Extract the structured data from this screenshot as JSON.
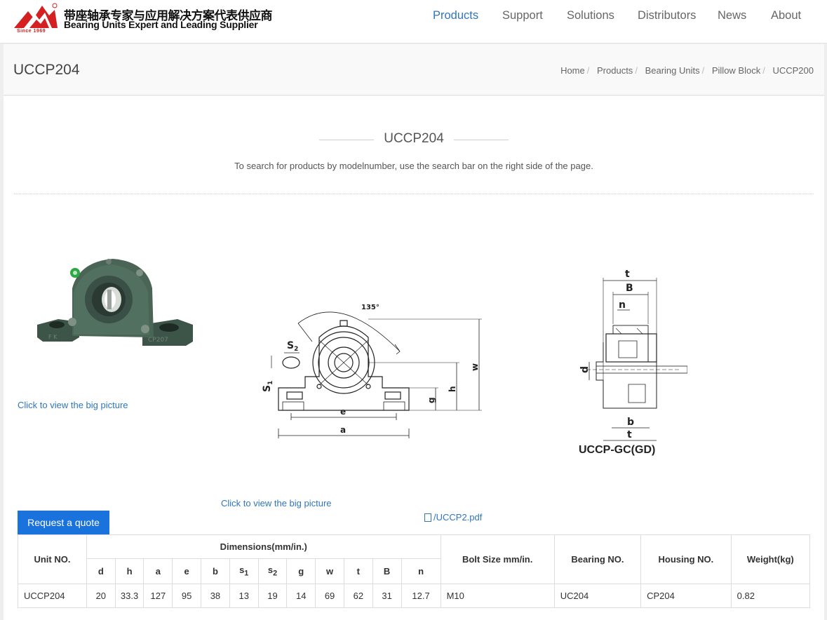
{
  "header": {
    "logo_since": "Since 1969",
    "logo_cn": "带座轴承专家与应用解决方案代表供应商",
    "logo_en": "Bearing Units Expert and Leading Supplier",
    "brand_color": "#d42020",
    "nav": [
      {
        "label": "Products",
        "active": true
      },
      {
        "label": "Support",
        "active": false
      },
      {
        "label": "Solutions",
        "active": false
      },
      {
        "label": "Distributors",
        "active": false
      },
      {
        "label": "News",
        "active": false
      },
      {
        "label": "About",
        "active": false
      }
    ]
  },
  "titlebar": {
    "title": "UCCP204",
    "breadcrumb": [
      "Home",
      "Products",
      "Bearing Units",
      "Pillow Block",
      "UCCP200"
    ]
  },
  "main": {
    "heading": "UCCP204",
    "subtext": "To search for products by modelnumber, use the search bar on the right side of the page.",
    "big_picture_link_1": "Click to view the big picture",
    "big_picture_link_2": "Click to view the big picture",
    "product_casting_1": "F K",
    "product_casting_2": "CP207",
    "drawing_label": "UCCP-GC(GD)",
    "drawing_angle": "135°",
    "drawing_dims": {
      "s2": "S",
      "s2_sub": "2",
      "s1": "S",
      "s1_sub": "1",
      "e": "e",
      "a": "a",
      "h": "h",
      "w": "w",
      "g": "g",
      "t": "t",
      "B": "B",
      "n": "n",
      "d": "d",
      "b": "b"
    },
    "pdf_link": "/UCCP2.pdf",
    "quote_button": "Request a quote"
  },
  "table": {
    "headers": {
      "unit_no": "Unit NO.",
      "dimensions": "Dimensions(mm/in.)",
      "bolt_size": "Bolt Size mm/in.",
      "bearing_no": "Bearing NO.",
      "housing_no": "Housing NO.",
      "weight": "Weight(kg)"
    },
    "dim_cols": [
      "d",
      "h",
      "a",
      "e",
      "b",
      "s",
      "s",
      "g",
      "w",
      "t",
      "B",
      "n"
    ],
    "dim_col_subs": [
      "",
      "",
      "",
      "",
      "",
      "1",
      "2",
      "",
      "",
      "",
      "",
      ""
    ],
    "rows": [
      {
        "unit_no": "UCCP204",
        "dims": [
          "20",
          "33.3",
          "127",
          "95",
          "38",
          "13",
          "19",
          "14",
          "69",
          "62",
          "31",
          "12.7"
        ],
        "bolt_size": "M10",
        "bearing_no": "UC204",
        "housing_no": "CP204",
        "weight": "0.82"
      }
    ]
  },
  "colors": {
    "accent": "#2f75c2",
    "button": "#1a72dd"
  }
}
